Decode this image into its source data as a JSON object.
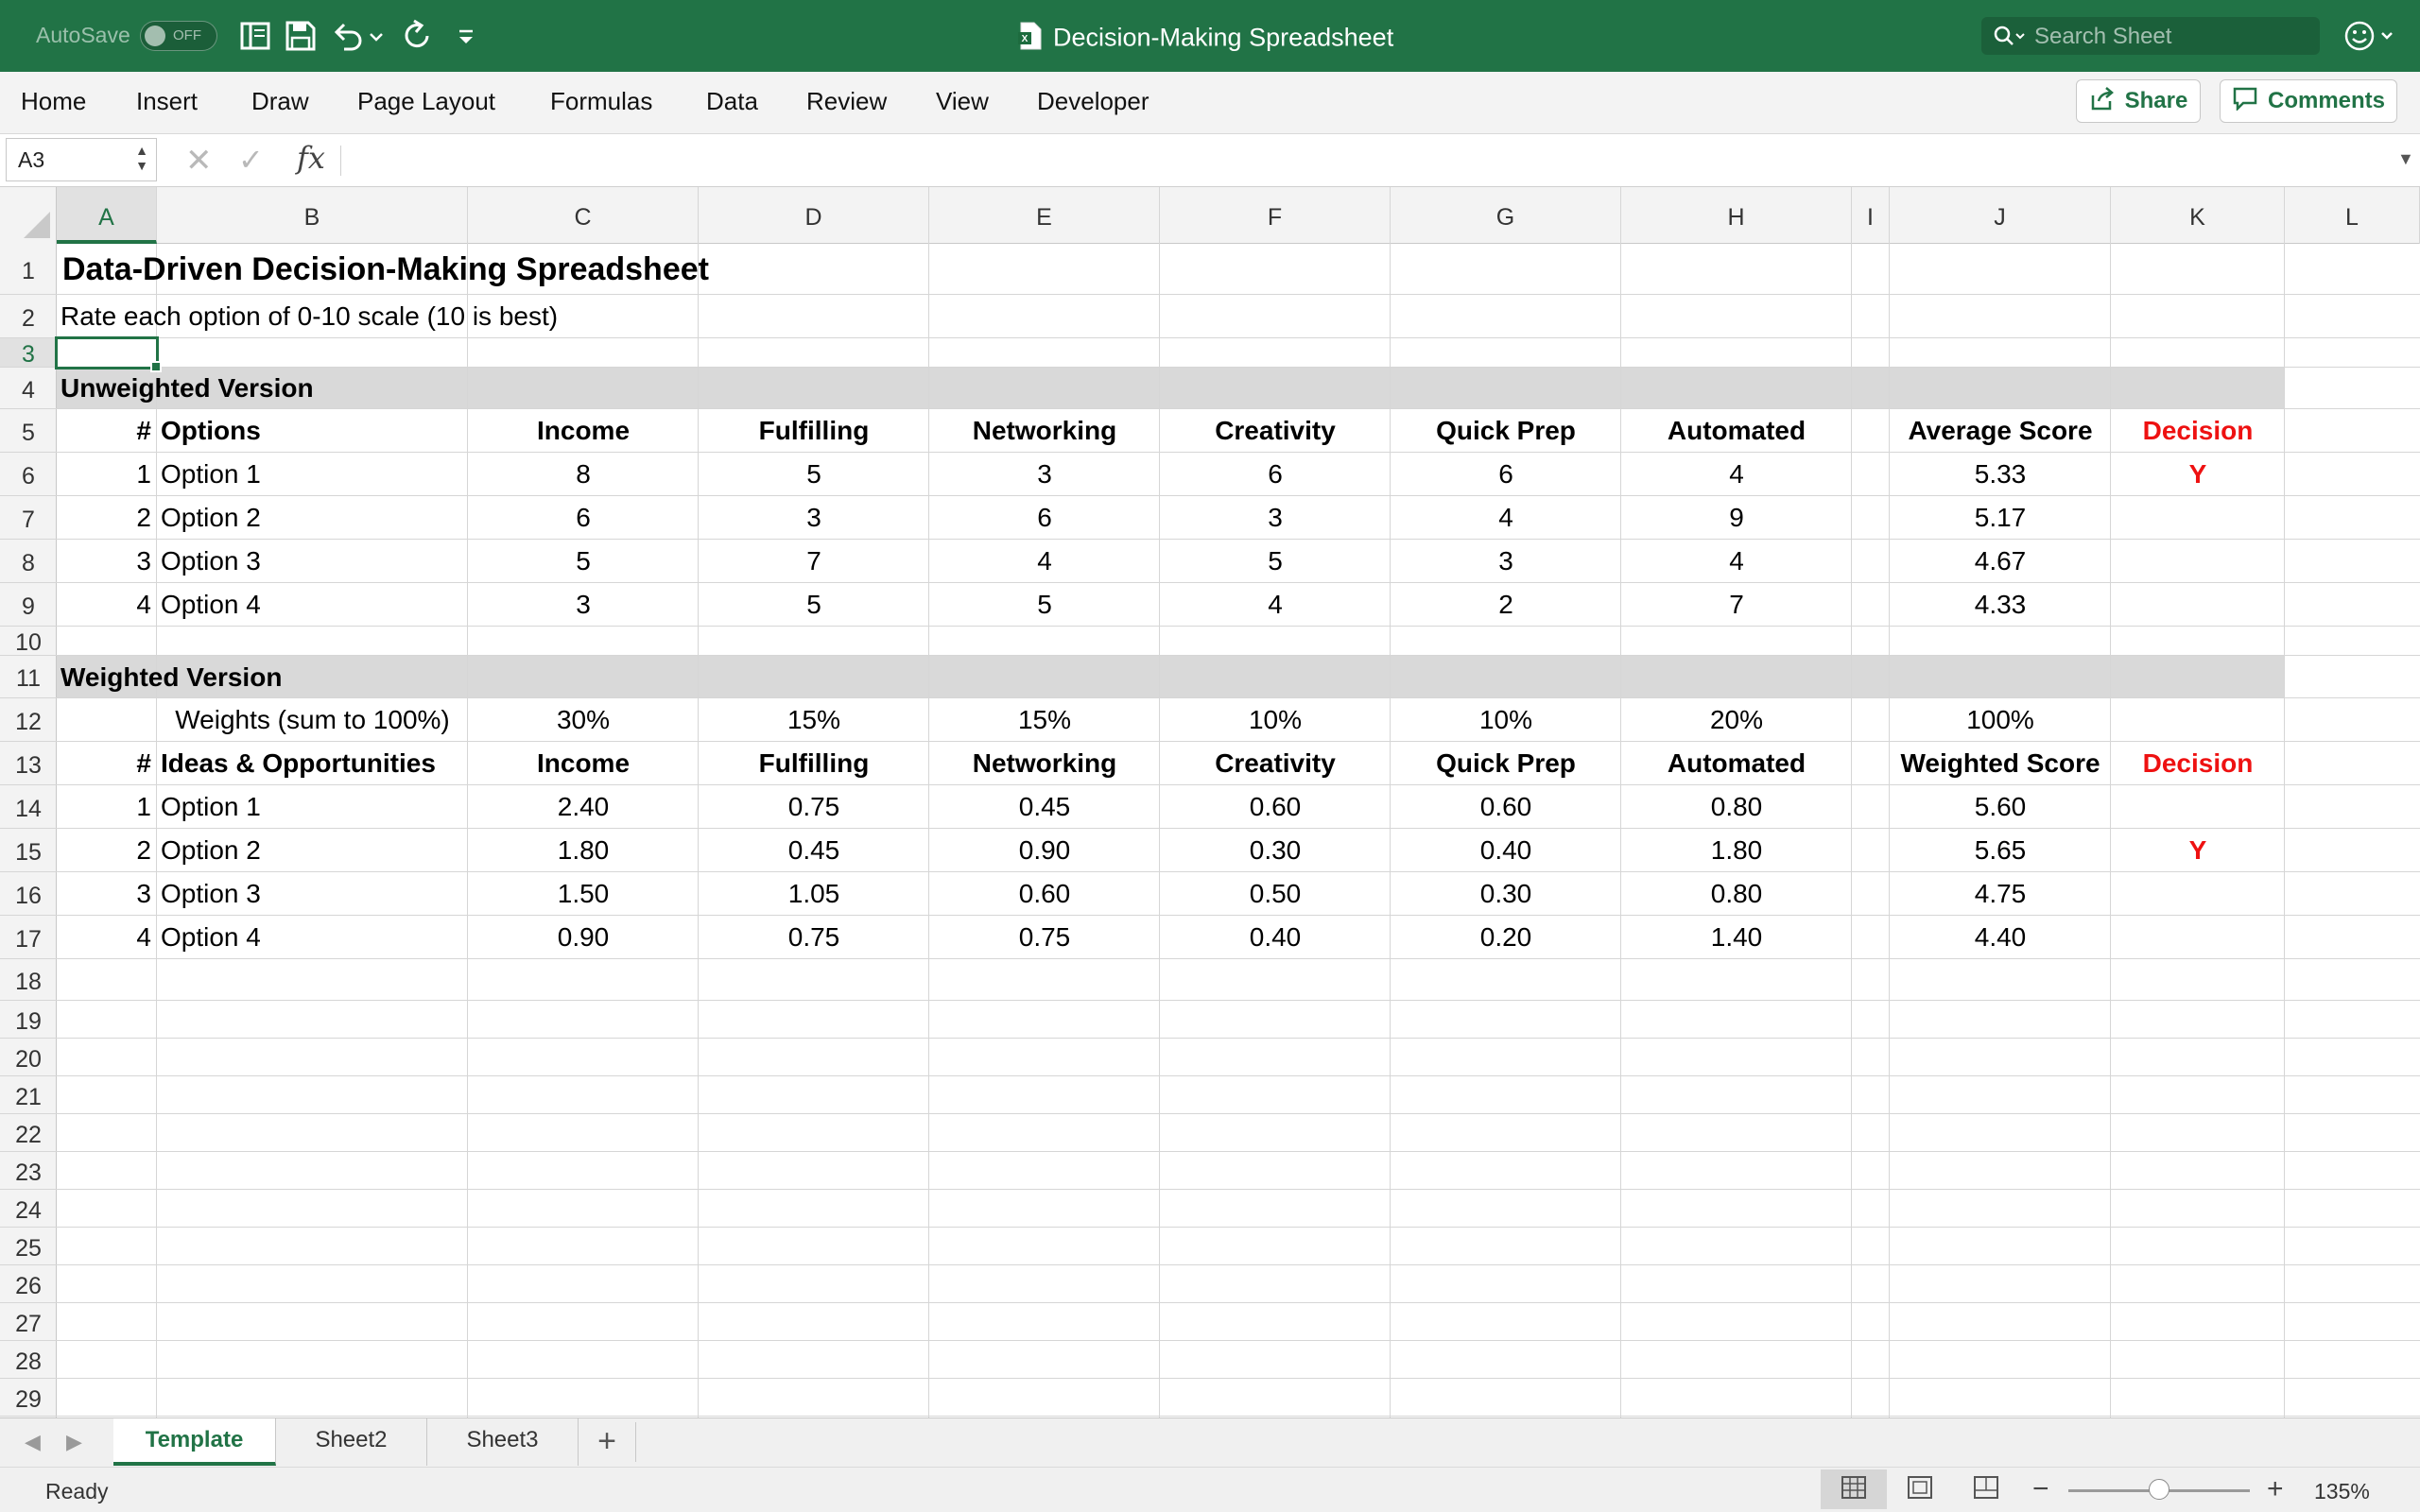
{
  "titlebar": {
    "autosave_label": "AutoSave",
    "autosave_state": "OFF",
    "document_title": "Decision-Making Spreadsheet",
    "search_placeholder": "Search Sheet",
    "background_color": "#217346"
  },
  "ribbon": {
    "tabs": [
      "Home",
      "Insert",
      "Draw",
      "Page Layout",
      "Formulas",
      "Data",
      "Review",
      "View",
      "Developer"
    ],
    "share_label": "Share",
    "comments_label": "Comments"
  },
  "formula_bar": {
    "name_box": "A3",
    "fx_label": "fx",
    "value": ""
  },
  "columns": [
    "A",
    "B",
    "C",
    "D",
    "E",
    "F",
    "G",
    "H",
    "I",
    "J",
    "K",
    "L"
  ],
  "selected_column": "A",
  "selected_row": "3",
  "rows": [
    "1",
    "2",
    "3",
    "4",
    "5",
    "6",
    "7",
    "8",
    "9",
    "10",
    "11",
    "12",
    "13",
    "14",
    "15",
    "16",
    "17",
    "18",
    "19",
    "20",
    "21",
    "22",
    "23",
    "24",
    "25",
    "26",
    "27",
    "28",
    "29"
  ],
  "sheet": {
    "title": "Data-Driven Decision-Making Spreadsheet",
    "subtitle": "Rate each option of 0-10 scale (10 is best)",
    "unweighted": {
      "section_label": "Unweighted Version",
      "headers": [
        "#",
        "Options",
        "Income",
        "Fulfilling",
        "Networking",
        "Creativity",
        "Quick Prep",
        "Automated",
        "Average Score",
        "Decision"
      ],
      "rows": [
        {
          "num": "1",
          "option": "Option 1",
          "vals": [
            "8",
            "5",
            "3",
            "6",
            "6",
            "4"
          ],
          "score": "5.33",
          "decision": "Y"
        },
        {
          "num": "2",
          "option": "Option 2",
          "vals": [
            "6",
            "3",
            "6",
            "3",
            "4",
            "9"
          ],
          "score": "5.17",
          "decision": ""
        },
        {
          "num": "3",
          "option": "Option 3",
          "vals": [
            "5",
            "7",
            "4",
            "5",
            "3",
            "4"
          ],
          "score": "4.67",
          "decision": ""
        },
        {
          "num": "4",
          "option": "Option 4",
          "vals": [
            "3",
            "5",
            "5",
            "4",
            "2",
            "7"
          ],
          "score": "4.33",
          "decision": ""
        }
      ]
    },
    "weighted": {
      "section_label": "Weighted Version",
      "weights_label": "Weights (sum to 100%)",
      "weights": [
        "30%",
        "15%",
        "15%",
        "10%",
        "10%",
        "20%"
      ],
      "weights_total": "100%",
      "headers": [
        "#",
        "Ideas & Opportunities",
        "Income",
        "Fulfilling",
        "Networking",
        "Creativity",
        "Quick Prep",
        "Automated",
        "Weighted Score",
        "Decision"
      ],
      "rows": [
        {
          "num": "1",
          "option": "Option 1",
          "vals": [
            "2.40",
            "0.75",
            "0.45",
            "0.60",
            "0.60",
            "0.80"
          ],
          "score": "5.60",
          "decision": ""
        },
        {
          "num": "2",
          "option": "Option 2",
          "vals": [
            "1.80",
            "0.45",
            "0.90",
            "0.30",
            "0.40",
            "1.80"
          ],
          "score": "5.65",
          "decision": "Y"
        },
        {
          "num": "3",
          "option": "Option 3",
          "vals": [
            "1.50",
            "1.05",
            "0.60",
            "0.50",
            "0.30",
            "0.80"
          ],
          "score": "4.75",
          "decision": ""
        },
        {
          "num": "4",
          "option": "Option 4",
          "vals": [
            "0.90",
            "0.75",
            "0.75",
            "0.40",
            "0.20",
            "1.40"
          ],
          "score": "4.40",
          "decision": ""
        }
      ]
    }
  },
  "sheet_tabs": [
    "Template",
    "Sheet2",
    "Sheet3"
  ],
  "active_sheet": "Template",
  "status": {
    "text": "Ready",
    "zoom": "135%",
    "zoom_fraction": 0.5
  },
  "colors": {
    "accent": "#217346",
    "decision_red": "#ee1111",
    "section_band": "#d9d9d9"
  }
}
